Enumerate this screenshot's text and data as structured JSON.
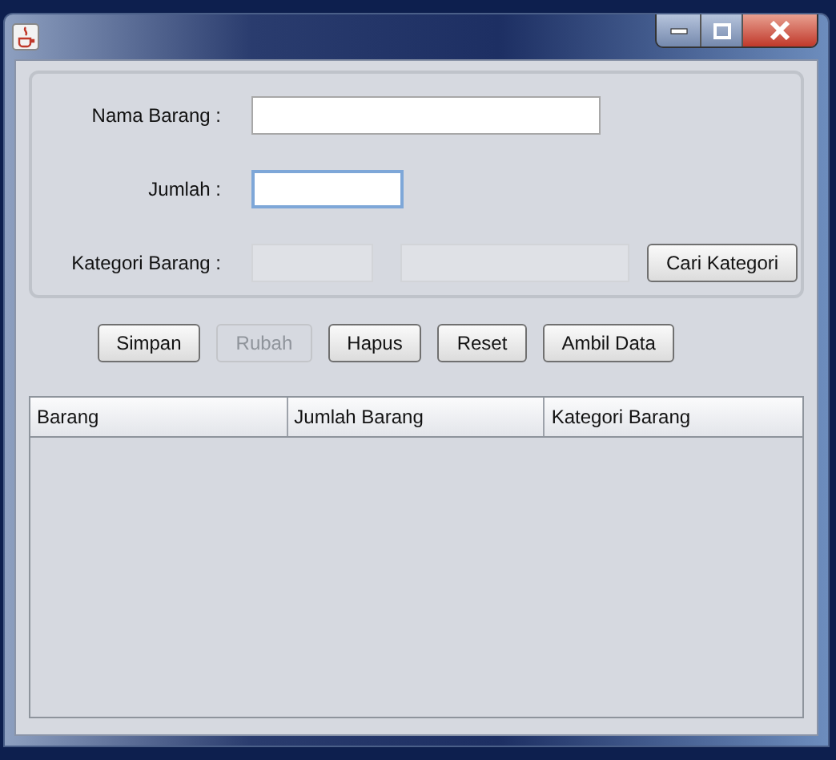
{
  "window": {
    "controls": [
      {
        "kind": "minimize"
      },
      {
        "kind": "maximize"
      },
      {
        "kind": "close"
      }
    ]
  },
  "form": {
    "fields": [
      {
        "label": "Nama Barang :",
        "inputs": [
          {
            "kind": "text",
            "disabled": false,
            "focused": false
          }
        ]
      },
      {
        "label": "Jumlah :",
        "inputs": [
          {
            "kind": "short",
            "disabled": false,
            "focused": true
          }
        ]
      },
      {
        "label": "Kategori Barang :",
        "inputs": [
          {
            "kind": "short",
            "disabled": true,
            "focused": false
          },
          {
            "kind": "text",
            "disabled": true,
            "focused": false
          }
        ],
        "button": {
          "label": "Cari Kategori",
          "disabled": false
        }
      }
    ]
  },
  "buttons": [
    {
      "label": "Simpan",
      "disabled": false
    },
    {
      "label": "Rubah",
      "disabled": true
    },
    {
      "label": "Hapus",
      "disabled": false
    },
    {
      "label": "Reset",
      "disabled": false
    },
    {
      "label": "Ambil Data",
      "disabled": false
    }
  ],
  "table": {
    "columns": [
      "Barang",
      "Jumlah Barang",
      "Kategori Barang"
    ]
  }
}
